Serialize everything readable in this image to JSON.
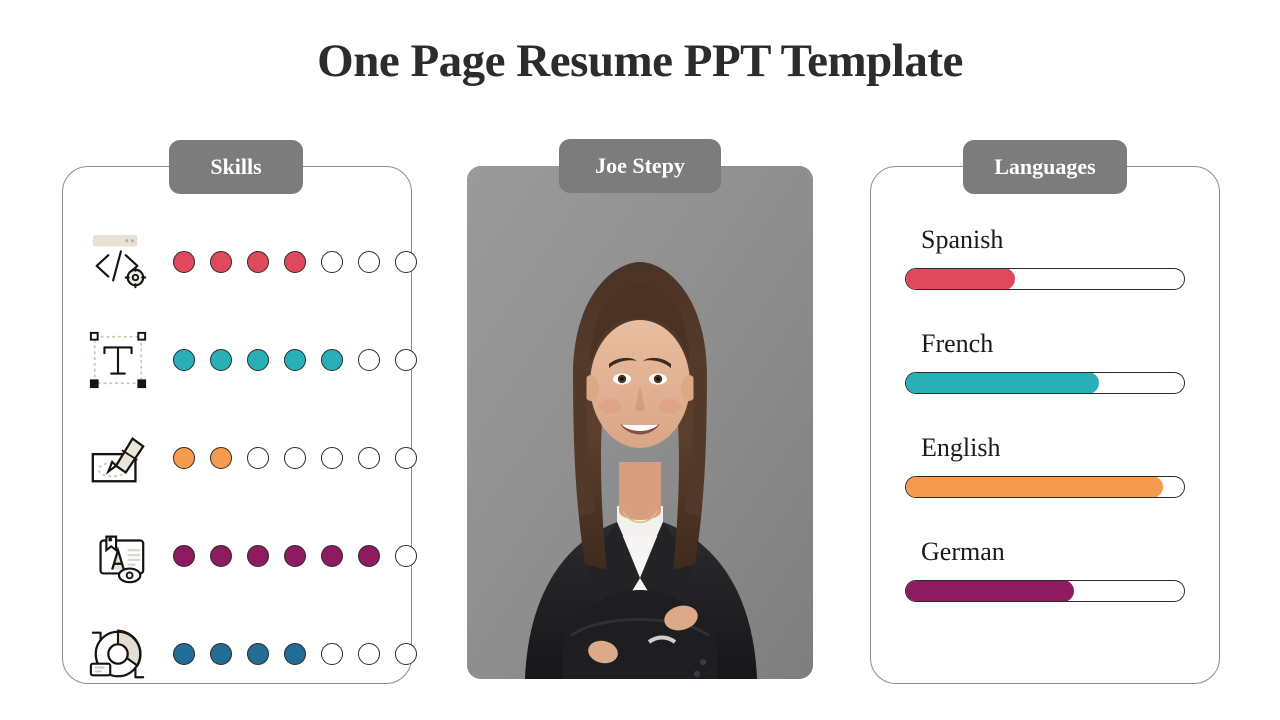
{
  "title": "One Page Resume PPT Template",
  "skills_card": {
    "badge_label": "Skills",
    "max_dots": 7,
    "rows": [
      {
        "icon": "code-window-gear-icon",
        "icon_label": "Coding",
        "filled": 4,
        "color": "#e0495c"
      },
      {
        "icon": "typography-text-icon",
        "icon_label": "Typography",
        "filled": 5,
        "color": "#28b0b6"
      },
      {
        "icon": "highlighter-marker-icon",
        "icon_label": "Illustration",
        "filled": 2,
        "color": "#f69b4d"
      },
      {
        "icon": "branding-label-icon",
        "icon_label": "Branding",
        "filled": 6,
        "color": "#8e1a5f"
      },
      {
        "icon": "donut-chart-icon",
        "icon_label": "Analytics",
        "filled": 4,
        "color": "#226d96"
      }
    ]
  },
  "profile": {
    "name_badge_label": "Joe Stepy",
    "photo_alt": "professional-headshot-photo"
  },
  "languages_card": {
    "badge_label": "Languages",
    "items": [
      {
        "name": "Spanish",
        "percent": 39,
        "color": "#e0495c"
      },
      {
        "name": "French",
        "percent": 69,
        "color": "#28b0b6"
      },
      {
        "name": "English",
        "percent": 92,
        "color": "#f69b4d"
      },
      {
        "name": "German",
        "percent": 60,
        "color": "#8e1a5f"
      }
    ]
  },
  "theme": {
    "badge_gray": "#7c7c7c",
    "card_border": "#8d8d8d",
    "title_color": "#2c2c2c",
    "dot_outline": "#2b2b2b"
  }
}
